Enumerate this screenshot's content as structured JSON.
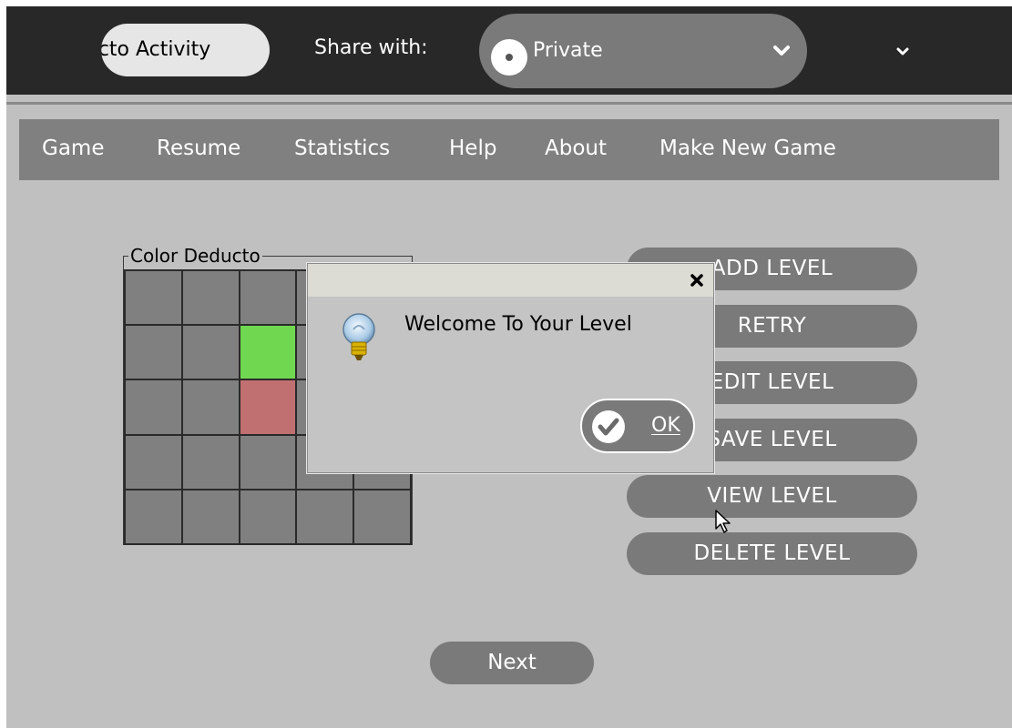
{
  "toolbar": {
    "activity_title": "Color Deducto Activity",
    "share_label": "Share with:",
    "share_value": "Private"
  },
  "menu": [
    "Game",
    "Resume",
    "Statistics",
    "Help",
    "About",
    "Make New Game"
  ],
  "board": {
    "title": "Color Deducto",
    "cells": [
      "gray",
      "gray",
      "gray",
      "gray",
      "gray",
      "gray",
      "gray",
      "green",
      "gray",
      "gray",
      "gray",
      "gray",
      "red",
      "gray",
      "gray",
      "gray",
      "gray",
      "gray",
      "gray",
      "gray",
      "gray",
      "gray",
      "gray",
      "gray",
      "gray"
    ]
  },
  "actions": {
    "add_level": "ADD LEVEL",
    "retry": "RETRY",
    "edit_level": "EDIT LEVEL",
    "save_level": "SAVE LEVEL",
    "view_level": "VIEW LEVEL",
    "delete_level": "DELETE LEVEL",
    "next": "Next"
  },
  "dialog": {
    "message": "Welcome To Your Level",
    "ok_label": "OK"
  },
  "colors": {
    "toolbar_bg": "#282828",
    "button_bg": "#7a7a7a",
    "cell_green": "#70d850",
    "cell_red": "#c07070"
  }
}
